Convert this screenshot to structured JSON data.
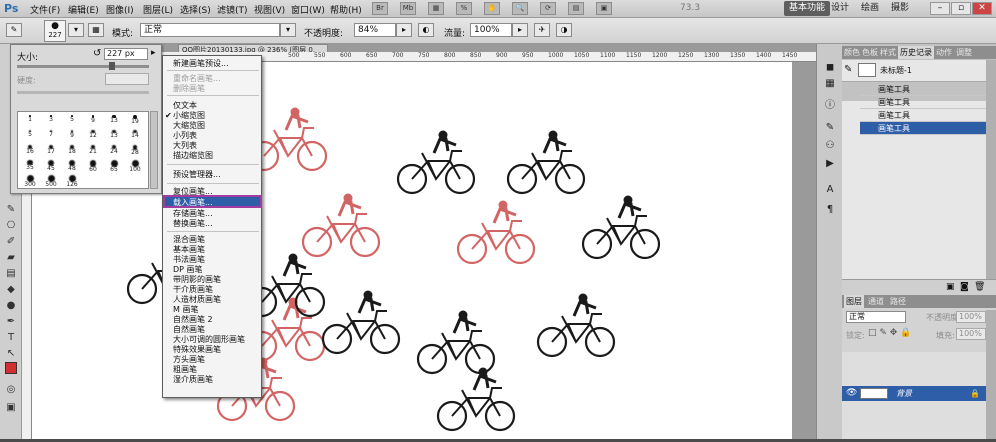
{
  "app": {
    "logo": "Ps"
  },
  "menubar": {
    "menus": [
      "文件(F)",
      "编辑(E)",
      "图像(I)",
      "图层(L)",
      "选择(S)",
      "滤镜(T)",
      "视图(V)",
      "窗口(W)",
      "帮助(H)"
    ],
    "zoom_value": "73.3",
    "workspaces": [
      "基本功能",
      "设计",
      "绘画",
      "摄影"
    ],
    "active_workspace": "基本功能"
  },
  "options": {
    "brush_size": "227",
    "mode_label": "模式:",
    "mode_value": "正常",
    "opacity_label": "不透明度:",
    "opacity_value": "84%",
    "flow_label": "流量:",
    "flow_value": "100%"
  },
  "document": {
    "tab_title": "QQ图片20130133.jpg @ 236% (图层 0, RGB/8#) *",
    "ruler_ticks": [
      "500",
      "550",
      "600",
      "650",
      "700",
      "750",
      "800",
      "850",
      "900",
      "950",
      "1000",
      "1050",
      "1100",
      "1150",
      "1200",
      "1250",
      "1300",
      "1350",
      "1400",
      "1450"
    ]
  },
  "brush_panel": {
    "size_label": "大小:",
    "size_value": "227 px",
    "hardness_label": "硬度:",
    "presets": [
      "1",
      "3",
      "5",
      "9",
      "13",
      "19",
      "5",
      "9",
      "13",
      "17",
      "21",
      "27",
      "35",
      "45",
      "65",
      "100",
      "200",
      "300",
      "14",
      "24",
      "27",
      "39",
      "46",
      "59",
      "11",
      "17",
      "23",
      "36",
      "44",
      "60",
      "14",
      "26",
      "33",
      "42",
      "55",
      "70",
      "112",
      "134",
      "74",
      "95",
      "29",
      "192",
      "36",
      "33",
      "63",
      "66",
      "39",
      "63",
      "11",
      "48",
      "32",
      "55",
      "100",
      "75",
      "45",
      "1106",
      "1499",
      "1284",
      "1454",
      "1646",
      "1764",
      "1790",
      "1789"
    ],
    "grid_rows": [
      [
        "1",
        "3",
        "5",
        "9",
        "13",
        "19"
      ],
      [
        "5",
        "7",
        "9",
        "12",
        "13",
        "14"
      ],
      [
        "16",
        "17",
        "18",
        "21",
        "24",
        "28"
      ],
      [
        "35",
        "45",
        "48",
        "60",
        "65",
        "100"
      ],
      [
        "300",
        "500",
        "126"
      ]
    ]
  },
  "context_menu": {
    "group1": [
      "新建画笔预设..."
    ],
    "group2": [
      "重命名画笔...",
      "删除画笔"
    ],
    "group3": [
      "仅文本",
      "小缩览图",
      "大缩览图",
      "小列表",
      "大列表",
      "描边缩览图"
    ],
    "checked": "小缩览图",
    "group4": [
      "预设管理器..."
    ],
    "group5": [
      "复位画笔...",
      "载入画笔...",
      "存储画笔...",
      "替换画笔..."
    ],
    "highlighted": "载入画笔...",
    "group6": [
      "混合画笔",
      "基本画笔",
      "书法画笔",
      "DP 画笔",
      "带阴影的画笔",
      "干介质画笔",
      "人造材质画笔",
      "M 画笔",
      "自然画笔 2",
      "自然画笔",
      "大小可调的圆形画笔",
      "特殊效果画笔",
      "方头画笔",
      "粗画笔",
      "湿介质画笔"
    ]
  },
  "right_panel": {
    "top_tabs": [
      "颜色",
      "色板",
      "样式",
      "历史记录",
      "动作",
      "调整"
    ],
    "active_top_tab": "历史记录",
    "snapshot": "未标题-1",
    "history": [
      "画笔工具",
      "画笔工具",
      "画笔工具",
      "画笔工具"
    ],
    "layer_tabs": [
      "图层",
      "通道",
      "路径"
    ],
    "active_layer_tab": "图层",
    "blend_mode": "正常",
    "opacity_label": "不透明度:",
    "opacity_value": "100%",
    "lock_label": "锁定:",
    "fill_label": "填充:",
    "fill_value": "100%",
    "layer_name": "背景"
  },
  "colors": {
    "foreground": "#d03030",
    "highlight": "#2f5ea8"
  }
}
